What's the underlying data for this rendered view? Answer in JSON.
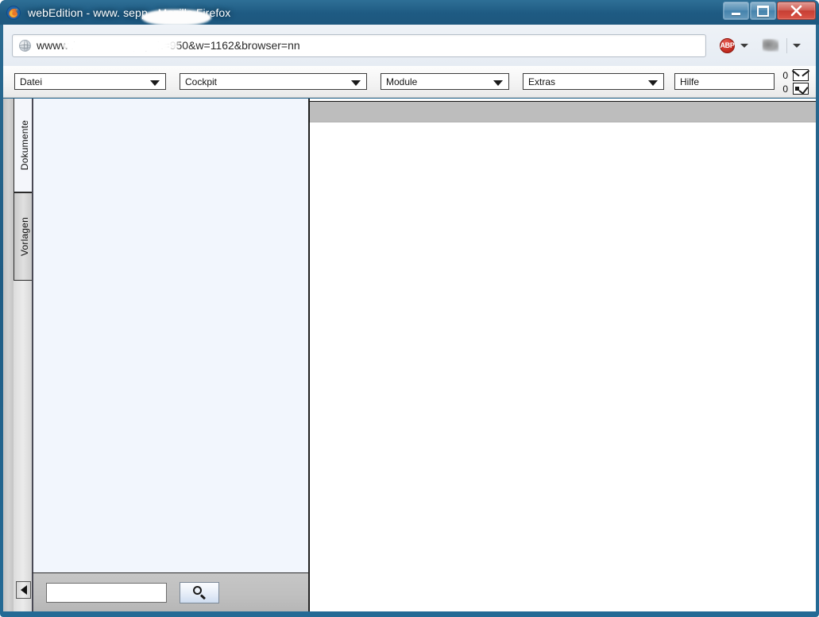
{
  "window": {
    "title": "webEdition - www.            sepp - Mozilla Firefox",
    "title_prefix": "webEdition - www.",
    "title_suffix": "sepp - Mozilla Firefox",
    "minimize_label": "Minimieren",
    "restore_label": "Wiederherstellen",
    "close_label": "Schließen"
  },
  "browser": {
    "url_prefix": "wwww",
    "url_suffix": "/webEdition.php?h=950&w=1162&browser=nn",
    "url_full": "wwww                    /webEdition.php?h=950&w=1162&browser=nn",
    "adblock_label": "ABP",
    "extension_label": "add-on"
  },
  "menubar": {
    "items": [
      {
        "label": "Datei",
        "has_caret": true
      },
      {
        "label": "Cockpit",
        "has_caret": true
      },
      {
        "label": "Module",
        "has_caret": true
      },
      {
        "label": "Extras",
        "has_caret": true
      },
      {
        "label": "Hilfe",
        "has_caret": false
      }
    ],
    "counters": [
      {
        "value": "0",
        "icon": "envelope-icon"
      },
      {
        "value": "0",
        "icon": "task-checkbox-icon"
      }
    ]
  },
  "sidebar": {
    "tabs": [
      {
        "label": "Dokumente",
        "active": true
      },
      {
        "label": "Vorlagen",
        "active": false
      }
    ],
    "collapse_label": "◀",
    "search": {
      "value": "",
      "placeholder": "",
      "button_icon": "magnifier-icon"
    }
  },
  "main": {
    "toolbar_empty": "",
    "body_empty": ""
  },
  "colors": {
    "titlebar": "#1f5c84",
    "frame": "#246a95",
    "tree_panel": "#f2f6fd",
    "toolbar_gray": "#bdbdbd",
    "search_bar": "#bfbfbf",
    "abp_red": "#c32b20",
    "close_red": "#c9453a"
  }
}
